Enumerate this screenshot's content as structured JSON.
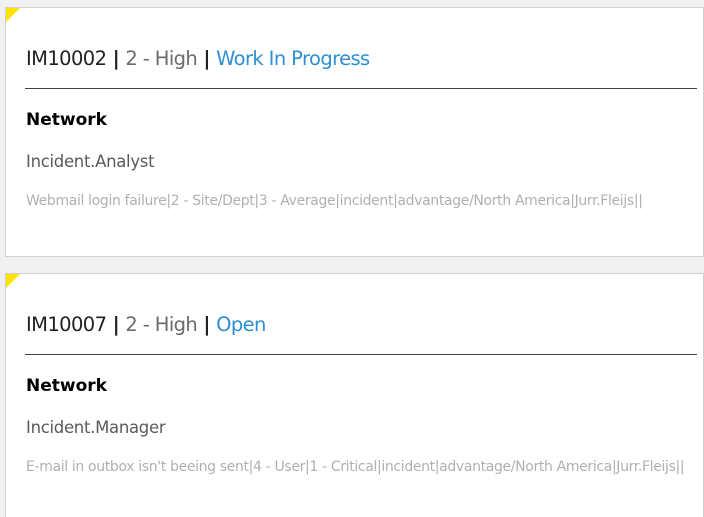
{
  "incidents": [
    {
      "id": "IM10002",
      "separator": " | ",
      "priority": "2 - High",
      "status": "Work In Progress",
      "category": "Network",
      "assignee": "Incident.Analyst",
      "details": "Webmail login failure|2 - Site/Dept|3 - Average|incident|advantage/North America|Jurr.Fleijs||"
    },
    {
      "id": "IM10007",
      "separator": " | ",
      "priority": "2 - High",
      "status": "Open",
      "category": "Network",
      "assignee": "Incident.Manager",
      "details": "E-mail in outbox isn't beeing sent|4 - User|1 - Critical|incident|advantage/North America|Jurr.Fleijs||"
    }
  ],
  "colors": {
    "status_link": "#2d8fd2",
    "corner_flag": "#ffe400",
    "card_background": "#ffffff",
    "page_background": "#f0f0f0"
  },
  "icons": {
    "corner_flag": "corner-flag-icon"
  }
}
